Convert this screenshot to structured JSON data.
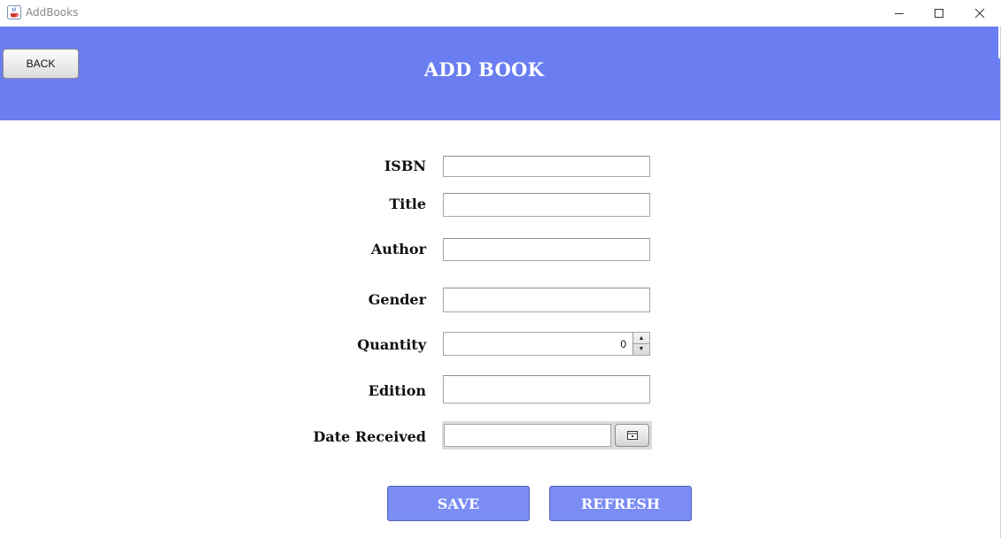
{
  "window": {
    "title": "AddBooks",
    "icon": "java-cup-icon"
  },
  "header": {
    "back_label": "BACK",
    "title": "ADD BOOK",
    "background": "#6a7ef2"
  },
  "form": {
    "isbn": {
      "label": "ISBN",
      "value": ""
    },
    "title": {
      "label": "Title",
      "value": ""
    },
    "author": {
      "label": "Author",
      "value": ""
    },
    "gender": {
      "label": "Gender",
      "value": ""
    },
    "quantity": {
      "label": "Quantity",
      "value": "0"
    },
    "edition": {
      "label": "Edition",
      "value": ""
    },
    "date_received": {
      "label": "Date Received",
      "value": "",
      "icon": "calendar-icon"
    }
  },
  "actions": {
    "save_label": "SAVE",
    "refresh_label": "REFRESH",
    "button_color": "#7b8cf5"
  }
}
